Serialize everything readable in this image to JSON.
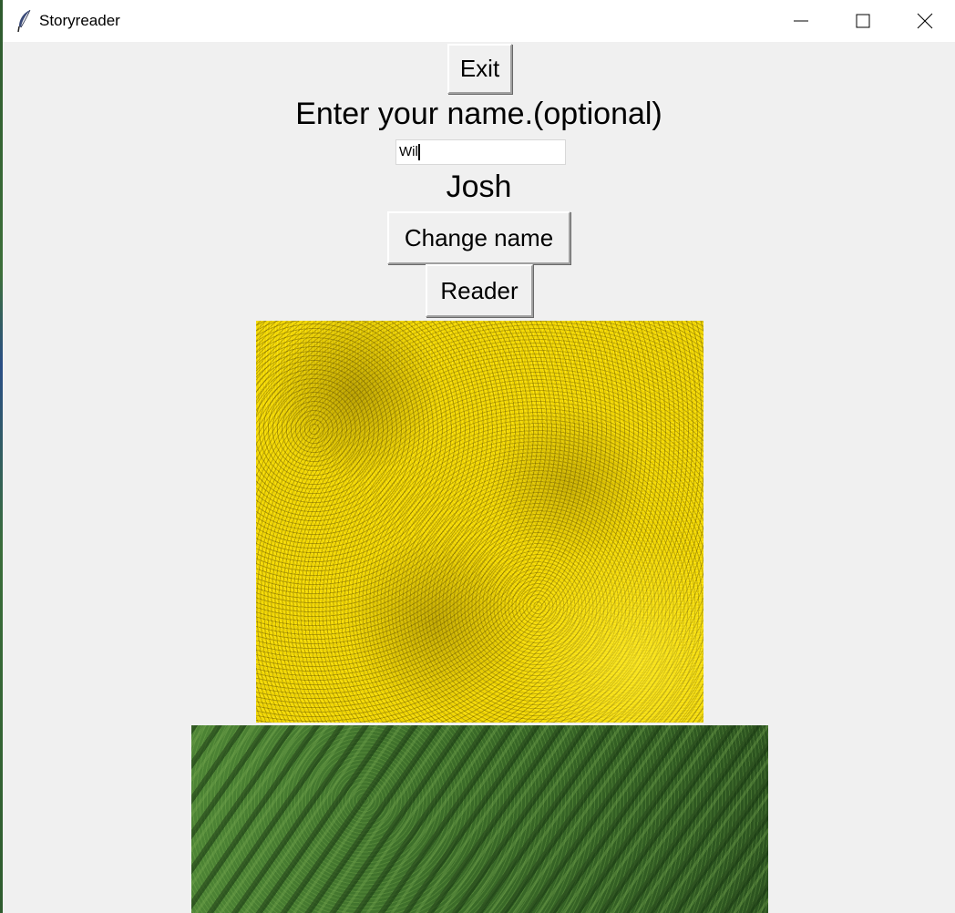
{
  "window": {
    "title": "Storyreader",
    "icon": "feather-icon",
    "controls": {
      "minimize_icon": "minimize-icon",
      "maximize_icon": "maximize-icon",
      "close_icon": "close-icon"
    }
  },
  "form": {
    "exit_label": "Exit",
    "prompt": "Enter your name.(optional)",
    "name_input_value": "Wil",
    "current_name": "Josh",
    "change_name_label": "Change name",
    "reader_label": "Reader"
  },
  "images": {
    "top": "yellow-rapeseed-field",
    "bottom": "green-grass-field"
  },
  "colors": {
    "background": "#f0f0f0",
    "titlebar": "#ffffff",
    "yellow_field": "#f0d400",
    "green_field": "#3d6e2a"
  }
}
